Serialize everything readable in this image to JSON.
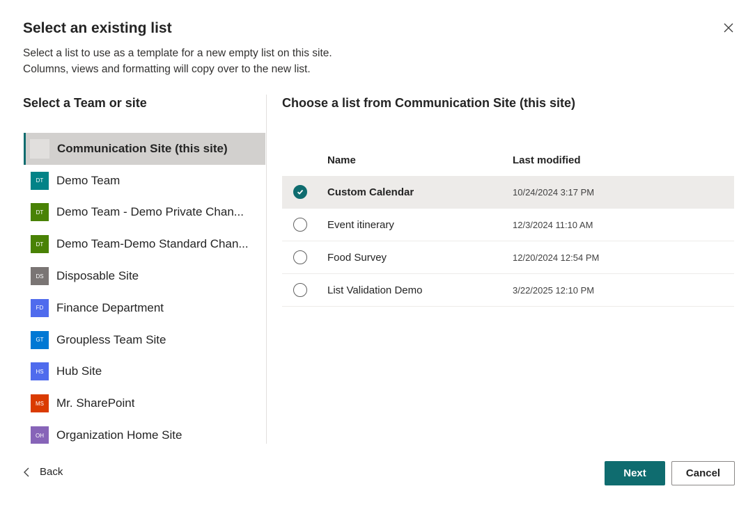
{
  "dialog": {
    "title": "Select an existing list",
    "description_line1": "Select a list to use as a template for a new empty list on this site.",
    "description_line2": "Columns, views and formatting will copy over to the new list."
  },
  "left": {
    "heading": "Select a Team or site",
    "sites": [
      {
        "label": "Communication Site (this site)",
        "initials": "",
        "color": "#e1dfdd",
        "selected": true
      },
      {
        "label": "Demo Team",
        "initials": "DT",
        "color": "#038387"
      },
      {
        "label": "Demo Team - Demo Private Chan...",
        "initials": "DT",
        "color": "#498205"
      },
      {
        "label": "Demo Team-Demo Standard Chan...",
        "initials": "DT",
        "color": "#498205"
      },
      {
        "label": "Disposable Site",
        "initials": "DS",
        "color": "#7a7574"
      },
      {
        "label": "Finance Department",
        "initials": "FD",
        "color": "#4f6bed"
      },
      {
        "label": "Groupless Team Site",
        "initials": "GT",
        "color": "#0078d4"
      },
      {
        "label": "Hub Site",
        "initials": "HS",
        "color": "#4f6bed"
      },
      {
        "label": "Mr. SharePoint",
        "initials": "MS",
        "color": "#da3b01"
      },
      {
        "label": "Organization Home Site",
        "initials": "OH",
        "color": "#8764b8"
      }
    ]
  },
  "right": {
    "heading": "Choose a list from Communication Site (this site)",
    "columns": {
      "name": "Name",
      "modified": "Last modified"
    },
    "rows": [
      {
        "name": "Custom Calendar",
        "modified": "10/24/2024 3:17 PM",
        "selected": true
      },
      {
        "name": "Event itinerary",
        "modified": "12/3/2024 11:10 AM"
      },
      {
        "name": "Food Survey",
        "modified": "12/20/2024 12:54 PM"
      },
      {
        "name": "List Validation Demo",
        "modified": "3/22/2025 12:10 PM"
      }
    ]
  },
  "footer": {
    "back_label": "Back",
    "next_label": "Next",
    "cancel_label": "Cancel"
  },
  "colors": {
    "accent": "#0f6c6f"
  }
}
